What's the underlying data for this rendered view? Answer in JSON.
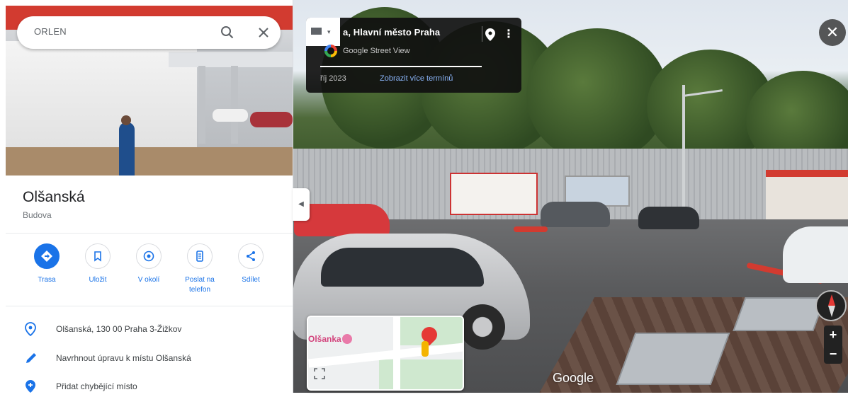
{
  "search": {
    "value": "ORLEN"
  },
  "place": {
    "name": "Olšanská",
    "type": "Budova"
  },
  "actions": [
    {
      "label": "Trasa",
      "icon": "directions-icon"
    },
    {
      "label": "Uložit",
      "icon": "bookmark-icon"
    },
    {
      "label": "V okolí",
      "icon": "nearby-icon"
    },
    {
      "label": "Poslat na telefon",
      "icon": "send-to-phone-icon"
    },
    {
      "label": "Sdílet",
      "icon": "share-icon"
    }
  ],
  "info_rows": [
    {
      "text": "Olšanská, 130 00 Praha 3-Žižkov",
      "icon": "location-pin-icon"
    },
    {
      "text": "Navrhnout úpravu k místu Olšanská",
      "icon": "edit-pencil-icon"
    },
    {
      "text": "Přidat chybějící místo",
      "icon": "add-place-icon"
    }
  ],
  "street_view": {
    "title": "a, Hlavní město Praha",
    "source": "Google Street View",
    "date": "říj 2023",
    "more_dates": "Zobrazit více termínů",
    "watermark": "Google"
  },
  "minimap": {
    "label": "Olšanka"
  },
  "colors": {
    "accent": "#1a73e8",
    "brand_red": "#d23b30"
  }
}
